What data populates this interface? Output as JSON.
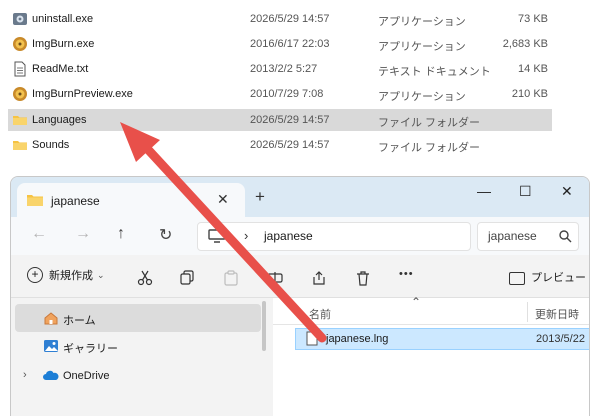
{
  "background_list": {
    "rows": [
      {
        "name": "uninstall.exe",
        "date": "2026/5/29 14:57",
        "type": "アプリケーション",
        "size": "73 KB",
        "icon": "setup-icon"
      },
      {
        "name": "ImgBurn.exe",
        "date": "2016/6/17 22:03",
        "type": "アプリケーション",
        "size": "2,683 KB",
        "icon": "imgburn-icon"
      },
      {
        "name": "ReadMe.txt",
        "date": "2013/2/2 5:27",
        "type": "テキスト ドキュメント",
        "size": "14 KB",
        "icon": "text-file-icon"
      },
      {
        "name": "ImgBurnPreview.exe",
        "date": "2010/7/29 7:08",
        "type": "アプリケーション",
        "size": "210 KB",
        "icon": "imgburn-icon"
      },
      {
        "name": "Languages",
        "date": "2026/5/29 14:57",
        "type": "ファイル フォルダー",
        "size": "",
        "icon": "folder-icon",
        "selected": true
      },
      {
        "name": "Sounds",
        "date": "2026/5/29 14:57",
        "type": "ファイル フォルダー",
        "size": "",
        "icon": "folder-icon"
      }
    ]
  },
  "explorer": {
    "tab_title": "japanese",
    "tab_close": "✕",
    "new_tab": "+",
    "window_controls": {
      "minimize": "—",
      "maximize": "☐",
      "close": "✕"
    },
    "nav": {
      "back": "←",
      "forward": "→",
      "up": "↑",
      "refresh": "↻"
    },
    "address": {
      "chevron": "›",
      "path": "japanese"
    },
    "search": {
      "placeholder": "japanese"
    },
    "toolbar": {
      "new_label": "新規作成",
      "new_dropdown": "⌄",
      "more": "•••",
      "preview_label": "プレビュー"
    },
    "sidebar": {
      "items": [
        {
          "label": "ホーム",
          "icon": "home-icon",
          "selected": true
        },
        {
          "label": "ギャラリー",
          "icon": "gallery-icon"
        },
        {
          "label": "OneDrive",
          "icon": "onedrive-icon",
          "expander": "›"
        }
      ]
    },
    "content": {
      "col_name": "名前",
      "col_sort": "⌃",
      "col_date": "更新日時",
      "files": [
        {
          "name": "japanese.lng",
          "date": "2013/5/22",
          "icon": "file-icon",
          "selected": true
        }
      ]
    }
  },
  "colors": {
    "arrow": "#e8504a",
    "selection": "#cce8ff",
    "titlebar": "#dbe9f4",
    "folder": "#f6c343"
  }
}
